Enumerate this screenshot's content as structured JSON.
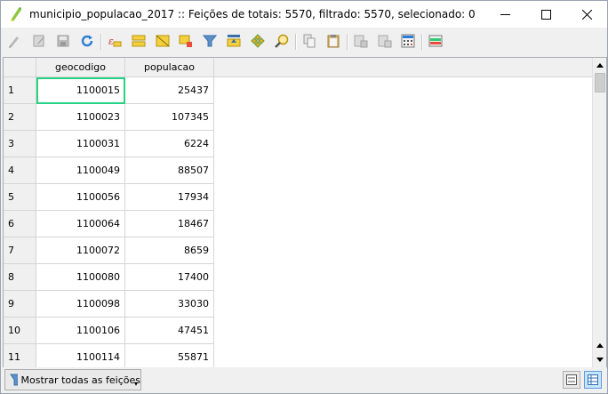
{
  "window": {
    "title": "municipio_populacao_2017 :: Feições de totais: 5570, filtrado: 5570, selecionado: 0"
  },
  "toolbar": {
    "buttons": [
      "pencil-icon",
      "save-edits-icon",
      "reload-icon",
      "refresh-icon",
      "expression-select-icon",
      "select-all-icon",
      "invert-selection-icon",
      "deselect-icon",
      "filter-select-icon",
      "move-to-top-icon",
      "pan-to-selected-icon",
      "zoom-to-selected-icon",
      "copy-icon",
      "paste-icon",
      "delete-field-icon",
      "new-field-icon",
      "field-calculator-icon",
      "conditional-formatting-icon"
    ]
  },
  "table": {
    "columns": [
      "geocodigo",
      "populacao"
    ],
    "rows": [
      {
        "n": "1",
        "geocodigo": "1100015",
        "populacao": "25437"
      },
      {
        "n": "2",
        "geocodigo": "1100023",
        "populacao": "107345"
      },
      {
        "n": "3",
        "geocodigo": "1100031",
        "populacao": "6224"
      },
      {
        "n": "4",
        "geocodigo": "1100049",
        "populacao": "88507"
      },
      {
        "n": "5",
        "geocodigo": "1100056",
        "populacao": "17934"
      },
      {
        "n": "6",
        "geocodigo": "1100064",
        "populacao": "18467"
      },
      {
        "n": "7",
        "geocodigo": "1100072",
        "populacao": "8659"
      },
      {
        "n": "8",
        "geocodigo": "1100080",
        "populacao": "17400"
      },
      {
        "n": "9",
        "geocodigo": "1100098",
        "populacao": "33030"
      },
      {
        "n": "10",
        "geocodigo": "1100106",
        "populacao": "47451"
      },
      {
        "n": "11",
        "geocodigo": "1100114",
        "populacao": "55871"
      }
    ],
    "selected_cell": "1100015"
  },
  "bottom": {
    "filter_label": "Mostrar todas as feições"
  },
  "colors": {
    "selection_outline": "#27d383",
    "active_view": "#cce4f7"
  }
}
